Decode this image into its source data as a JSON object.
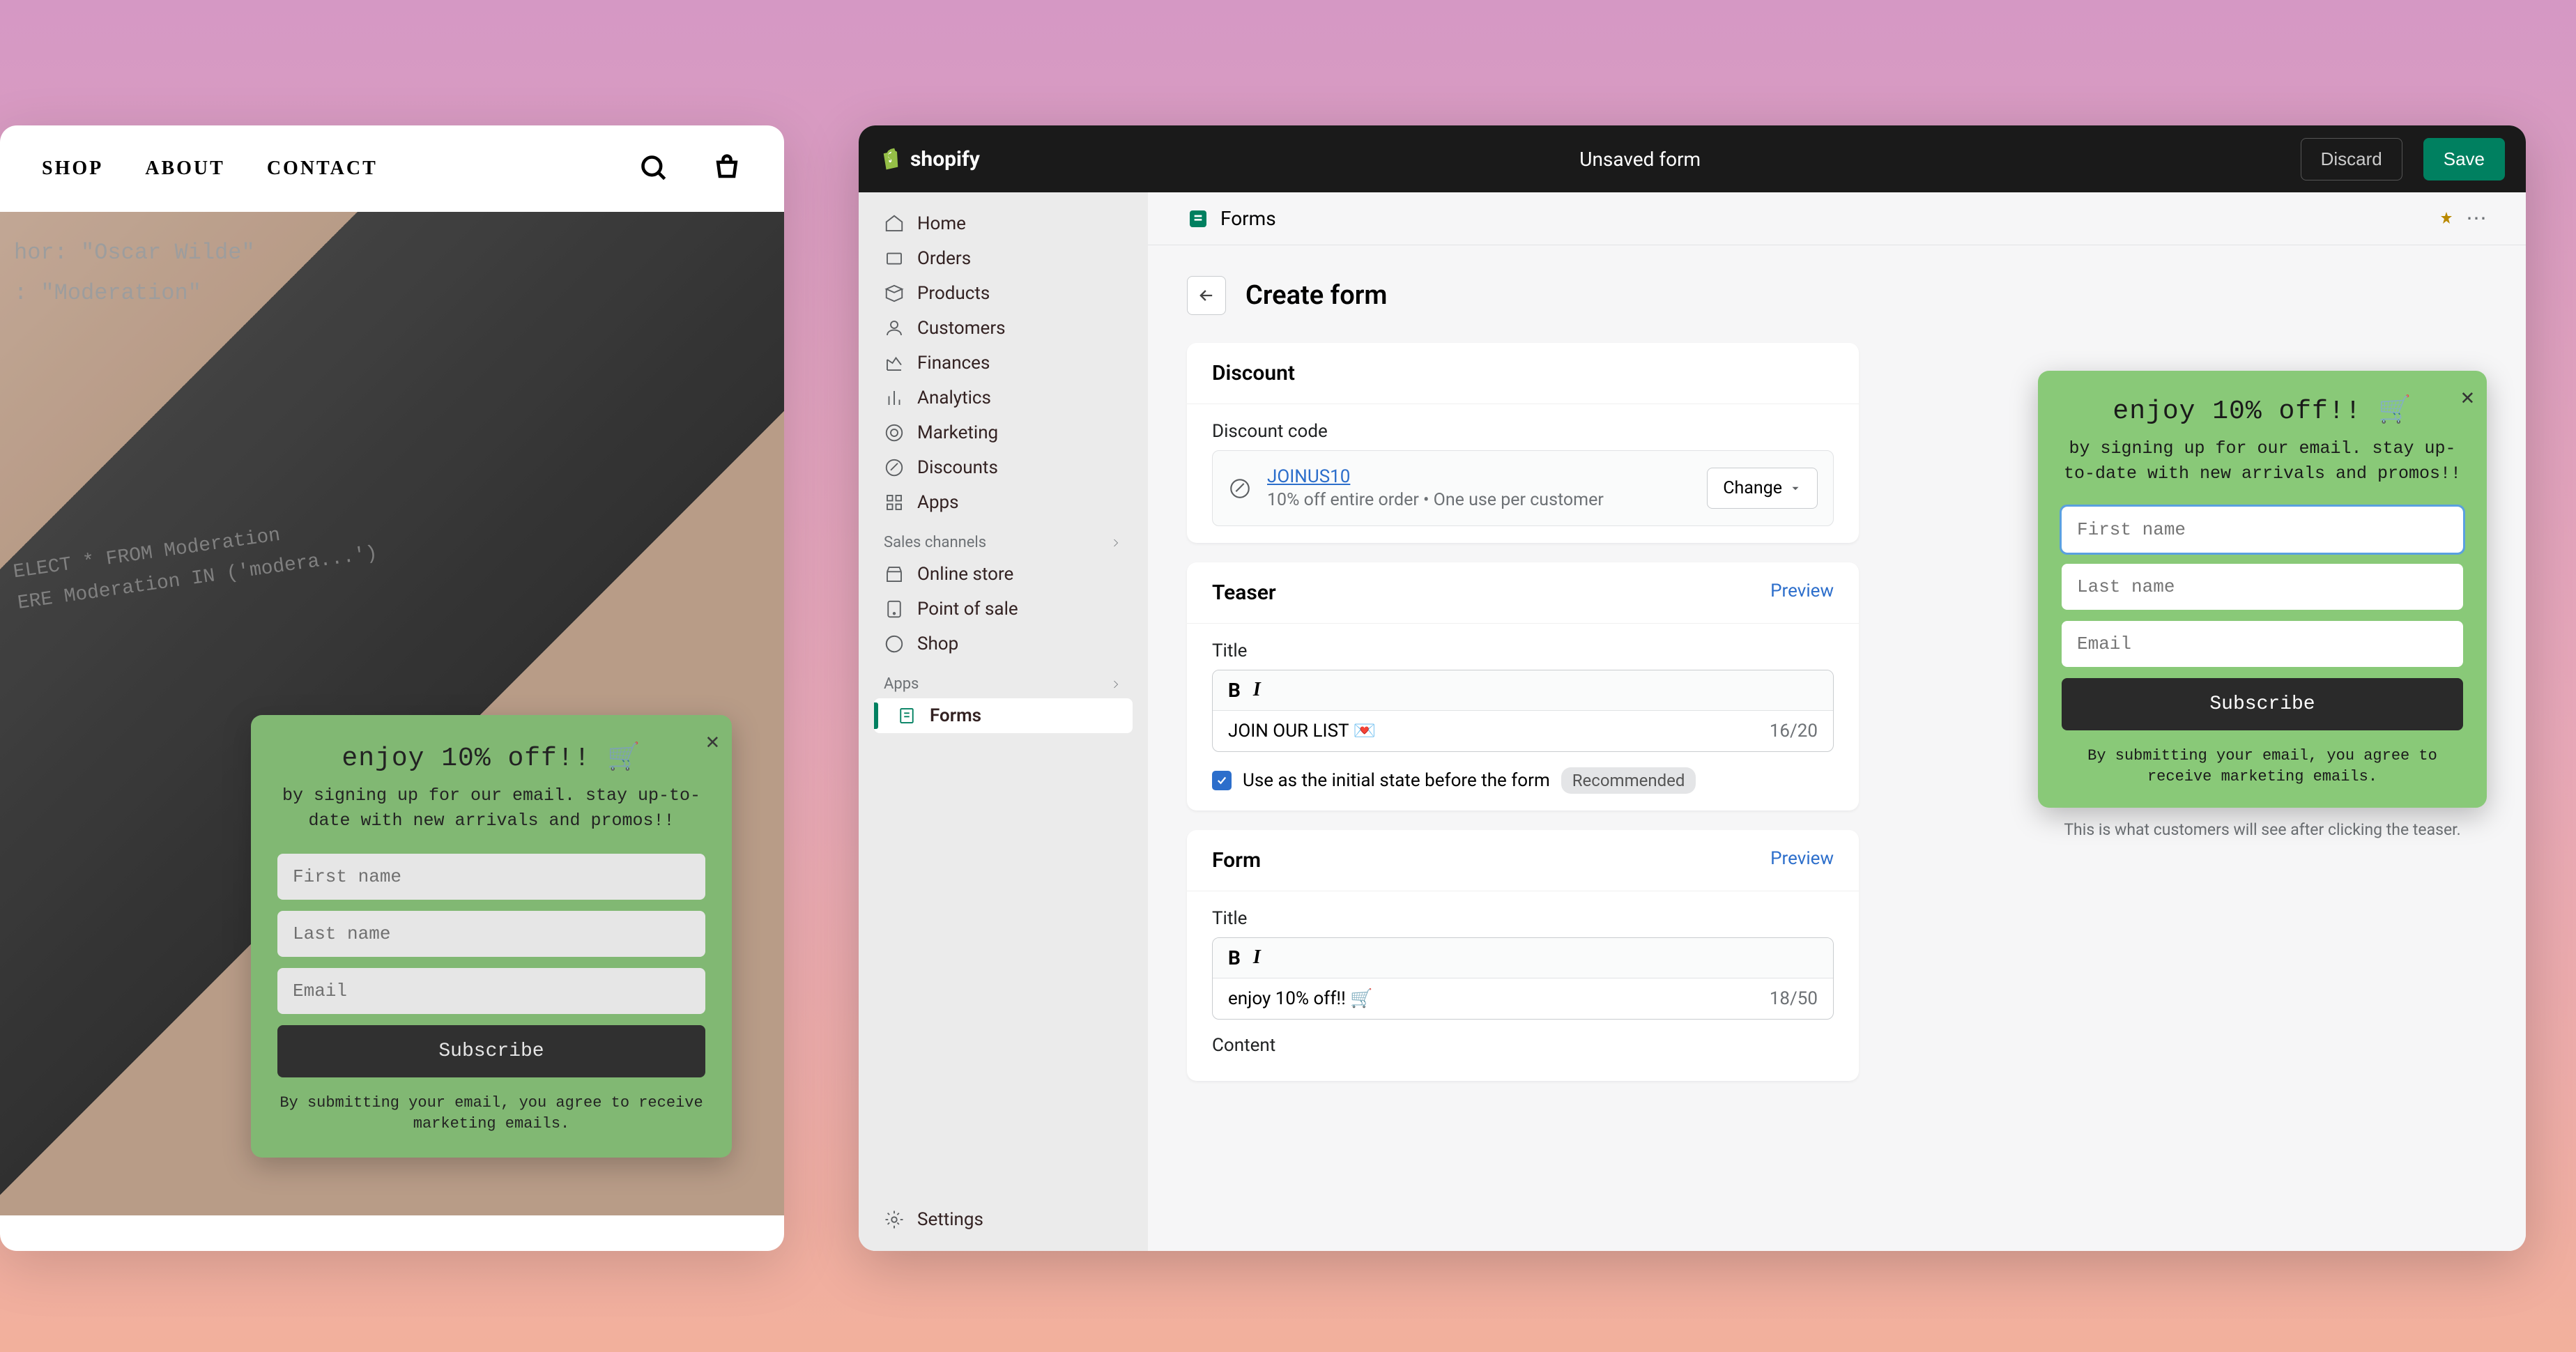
{
  "storefront": {
    "nav": {
      "shop": "SHOP",
      "about": "ABOUT",
      "contact": "CONTACT"
    },
    "hero_text1_l1": "hor: \"Oscar Wilde\"",
    "hero_text1_l2": ": \"Moderation\"",
    "hero_text2_l1": "ELECT * FROM Moderation",
    "hero_text2_l2": "ERE Moderation IN ('modera...')"
  },
  "popup": {
    "title": "enjoy 10% off!! 🛒",
    "subtitle": "by signing up for our email. stay up-to-date with new arrivals and promos!!",
    "first_name_ph": "First name",
    "last_name_ph": "Last name",
    "email_ph": "Email",
    "subscribe": "Subscribe",
    "legal": "By submitting your email, you agree to receive marketing emails."
  },
  "admin": {
    "brand": "shopify",
    "topbar_status": "Unsaved form",
    "discard": "Discard",
    "save": "Save",
    "nav": {
      "home": "Home",
      "orders": "Orders",
      "products": "Products",
      "customers": "Customers",
      "finances": "Finances",
      "analytics": "Analytics",
      "marketing": "Marketing",
      "discounts": "Discounts",
      "apps": "Apps",
      "sales_channels": "Sales channels",
      "online_store": "Online store",
      "pos": "Point of sale",
      "shop": "Shop",
      "apps_section": "Apps",
      "forms": "Forms",
      "settings": "Settings"
    },
    "app_header": "Forms",
    "page_title": "Create form",
    "discount": {
      "heading": "Discount",
      "label": "Discount code",
      "code": "JOINUS10",
      "desc": "10% off entire order • One use per customer",
      "change": "Change"
    },
    "teaser": {
      "heading": "Teaser",
      "preview": "Preview",
      "title_label": "Title",
      "title_value": "JOIN OUR LIST 💌",
      "title_count": "16/20",
      "checkbox_label": "Use as the initial state before the form",
      "recommended": "Recommended"
    },
    "form_section": {
      "heading": "Form",
      "preview": "Preview",
      "title_label": "Title",
      "title_value": "enjoy 10% off!! 🛒",
      "title_count": "18/50",
      "content_label": "Content"
    },
    "preview_caption": "This is what customers will see after clicking the teaser."
  }
}
